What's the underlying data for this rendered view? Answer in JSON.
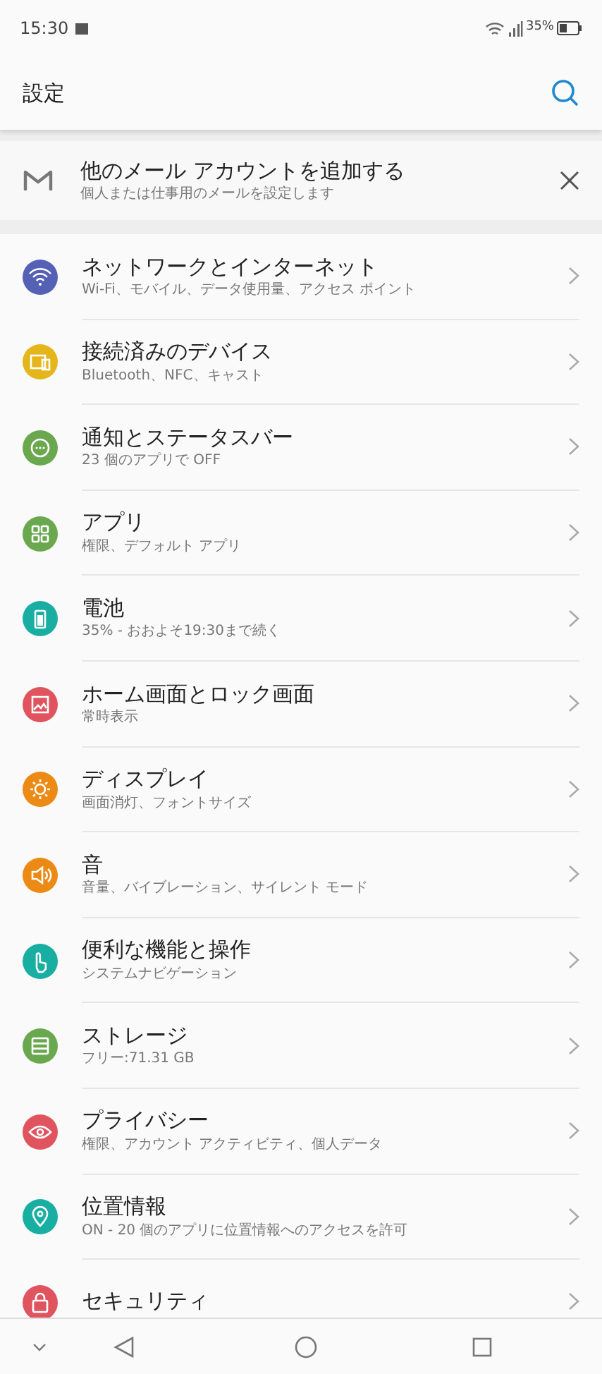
{
  "status_bar": {
    "time": "15:30",
    "battery_text": "35%"
  },
  "header": {
    "title": "設定"
  },
  "suggestion": {
    "title": "他のメール アカウントを追加する",
    "subtitle": "個人または仕事用のメールを設定します"
  },
  "items": [
    {
      "title": "ネットワークとインターネット",
      "subtitle": "Wi-Fi、モバイル、データ使用量、アクセス ポイント",
      "color": "#5561b4"
    },
    {
      "title": "接続済みのデバイス",
      "subtitle": "Bluetooth、NFC、キャスト",
      "color": "#e5b51c"
    },
    {
      "title": "通知とステータスバー",
      "subtitle": "23 個のアプリで OFF",
      "color": "#6aa84f"
    },
    {
      "title": "アプリ",
      "subtitle": "権限、デフォルト アプリ",
      "color": "#6aa84f"
    },
    {
      "title": "電池",
      "subtitle": "35% - おおよそ19:30まで続く",
      "color": "#19aea2"
    },
    {
      "title": "ホーム画面とロック画面",
      "subtitle": "常時表示",
      "color": "#e0545f"
    },
    {
      "title": "ディスプレイ",
      "subtitle": "画面消灯、フォントサイズ",
      "color": "#eb8a14"
    },
    {
      "title": "音",
      "subtitle": "音量、バイブレーション、サイレント モード",
      "color": "#eb8a14"
    },
    {
      "title": "便利な機能と操作",
      "subtitle": "システムナビゲーション",
      "color": "#19aea2"
    },
    {
      "title": "ストレージ",
      "subtitle": "フリー:71.31 GB",
      "color": "#6aa84f"
    },
    {
      "title": "プライバシー",
      "subtitle": "権限、アカウント アクティビティ、個人データ",
      "color": "#e0545f"
    },
    {
      "title": "位置情報",
      "subtitle": "ON - 20 個のアプリに位置情報へのアクセスを許可",
      "color": "#19aea2"
    },
    {
      "title": "セキュリティ",
      "color": "#e0545f"
    }
  ]
}
